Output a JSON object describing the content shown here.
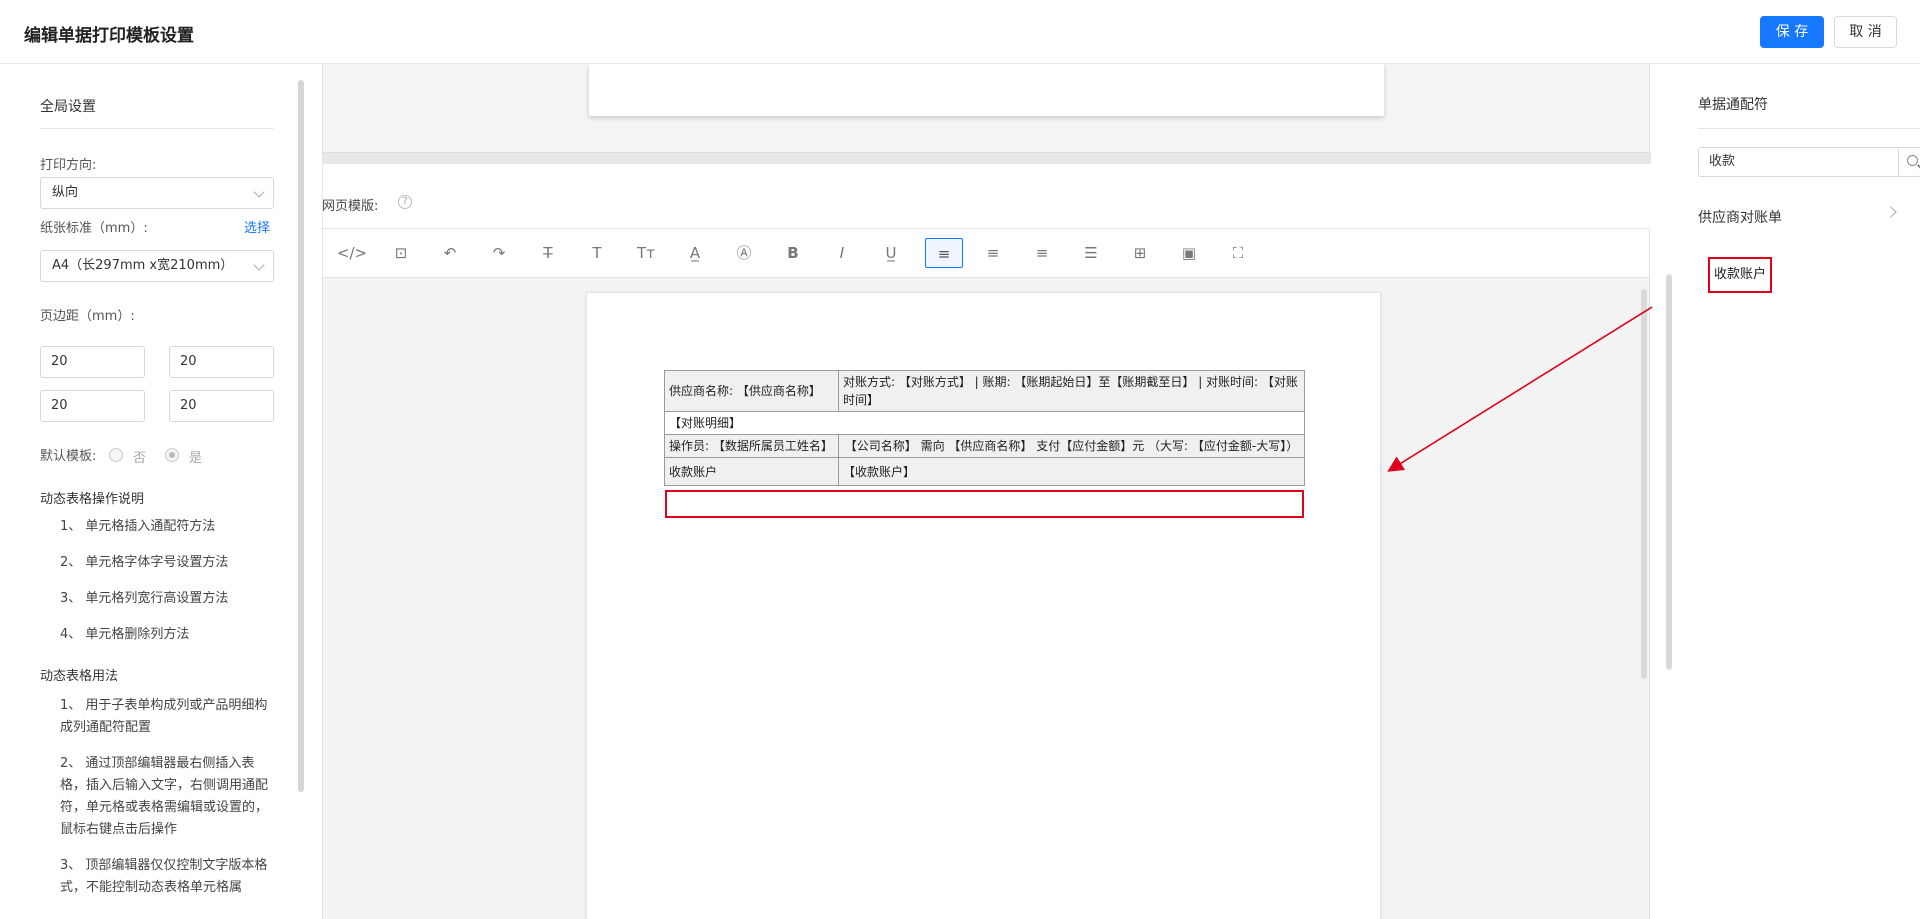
{
  "header": {
    "title": "编辑单据打印模板设置",
    "save_label": "保 存",
    "cancel_label": "取 消"
  },
  "left": {
    "global_title": "全局设置",
    "orientation_label": "打印方向:",
    "orientation_value": "纵向",
    "paper_label": "纸张标准（mm）:",
    "paper_choose": "选择",
    "paper_value": "A4（长297mm x宽210mm）",
    "margin_label": "页边距（mm）:",
    "margins": [
      "20",
      "20",
      "20",
      "20"
    ],
    "default_label": "默认模板:",
    "default_no": "否",
    "default_yes": "是",
    "ops_title": "动态表格操作说明",
    "ops_items": [
      "1、 单元格插入通配符方法",
      "2、 单元格字体字号设置方法",
      "3、 单元格列宽行高设置方法",
      "4、 单元格删除列方法"
    ],
    "usage_title": "动态表格用法",
    "usage_items": [
      "1、 用于子表单构成列或产品明细构成列通配符配置",
      "2、 通过顶部编辑器最右侧插入表格，插入后输入文字，右侧调用通配符，单元格或表格需编辑或设置的，鼠标右键点击后操作",
      "3、 顶部编辑器仅仅控制文字版本格式，不能控制动态表格单元格属"
    ]
  },
  "center": {
    "template_label": "网页模版:",
    "help_glyph": "?",
    "toolbar": [
      "</>",
      "⊡",
      "↶",
      "↷",
      "T̶",
      "T",
      "Tт",
      "A̲",
      "Ⓐ",
      "B",
      "I",
      "U̲",
      "≡",
      "≡",
      "≡",
      "☰",
      "⊞",
      "▣",
      "⛶"
    ],
    "table": {
      "r1c1": "供应商名称: 【供应商名称】",
      "r1c2": "对账方式: 【对账方式】 | 账期: 【账期起始日】至【账期截至日】 | 对账时间: 【对账时间】",
      "r2": "【对账明细】",
      "r3c1": "操作员: 【数据所属员工姓名】",
      "r3c2": "【公司名称】 需向 【供应商名称】 支付【应付金额】元 （大写: 【应付金额-大写】）",
      "r4c1": "收款账户",
      "r4c2": "【收款账户】"
    }
  },
  "right": {
    "title": "单据通配符",
    "search_value": "收款",
    "category": "供应商对账单",
    "token": "收款账户"
  },
  "colors": {
    "accent": "#1677ff",
    "highlight": "#e0001b"
  }
}
